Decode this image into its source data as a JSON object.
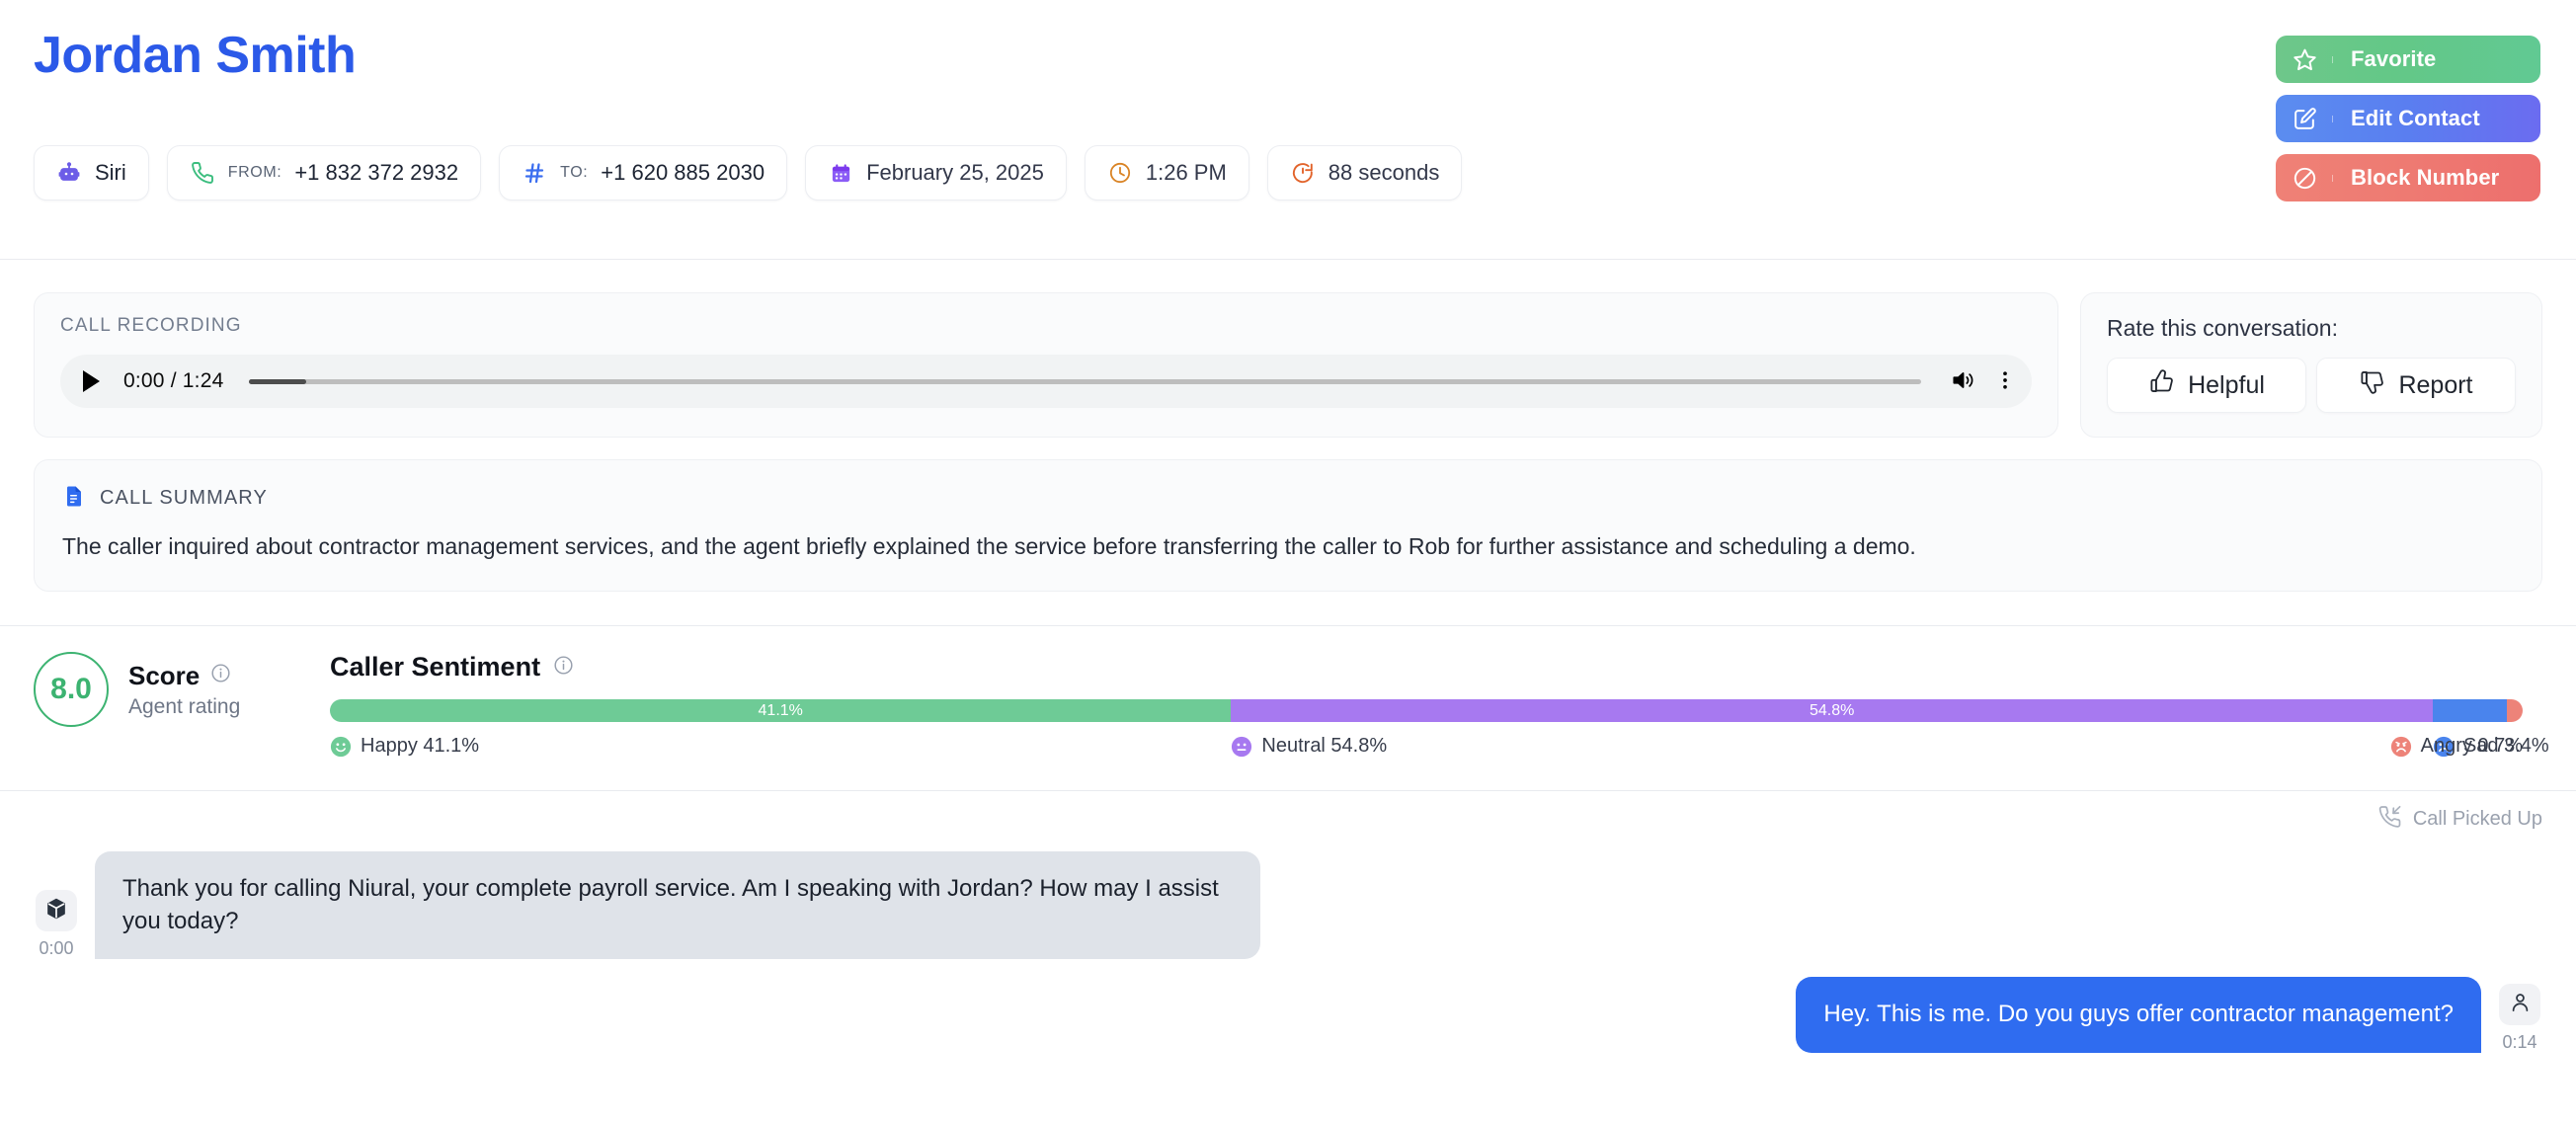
{
  "header": {
    "contact_name": "Jordan Smith",
    "chips": [
      {
        "icon": "robot-icon",
        "label": "",
        "value": "Siri"
      },
      {
        "icon": "phone-icon",
        "label": "FROM:",
        "value": "+1 832 372 2932"
      },
      {
        "icon": "hash-icon",
        "label": "TO:",
        "value": "+1 620 885 2030"
      },
      {
        "icon": "calendar-icon",
        "label": "",
        "value": "February 25, 2025"
      },
      {
        "icon": "clock-icon",
        "label": "",
        "value": "1:26 PM"
      },
      {
        "icon": "timer-icon",
        "label": "",
        "value": "88 seconds"
      }
    ],
    "actions": [
      {
        "icon": "star-icon",
        "label": "Favorite"
      },
      {
        "icon": "edit-pencil-icon",
        "label": "Edit Contact"
      },
      {
        "icon": "block-icon",
        "label": "Block Number"
      }
    ]
  },
  "recording": {
    "section_label": "CALL RECORDING",
    "current_time": "0:00",
    "duration": "1:24",
    "time_display": "0:00 / 1:24",
    "progress_percent": 0
  },
  "rate": {
    "prompt": "Rate this conversation:",
    "helpful_label": "Helpful",
    "report_label": "Report"
  },
  "summary": {
    "section_label": "CALL SUMMARY",
    "text": "The caller inquired about contractor management services, and the agent briefly explained the service before transferring the caller to Rob for further assistance and scheduling a demo."
  },
  "score": {
    "value": "8.0",
    "label": "Score",
    "sublabel": "Agent rating",
    "color": "#3cb371"
  },
  "sentiment": {
    "title": "Caller Sentiment"
  },
  "chart_data": {
    "type": "bar",
    "title": "Caller Sentiment",
    "orientation": "horizontal-stacked",
    "categories": [
      "Happy",
      "Neutral",
      "Sad",
      "Angry"
    ],
    "values": [
      41.1,
      54.8,
      3.4,
      0.7
    ],
    "value_labels": [
      "41.1%",
      "54.8%",
      "3.4%",
      "0.7%"
    ],
    "bar_labels": [
      "41.1%",
      "54.8%",
      "",
      ""
    ],
    "legend_labels": [
      "Happy 41.1%",
      "Neutral 54.8%",
      "Sad 3.4%",
      "Angry 0.7%"
    ],
    "colors": [
      "#6ecb96",
      "#a779f0",
      "#4a84ed",
      "#ed8379"
    ],
    "emojis": [
      "happy-face-icon",
      "neutral-face-icon",
      "sad-face-icon",
      "angry-face-icon"
    ],
    "total": 100,
    "legend": "bottom",
    "xlabel": "",
    "ylabel": ""
  },
  "transcript": {
    "call_status": "Call Picked Up",
    "messages": [
      {
        "speaker": "agent",
        "avatar": "cube-icon",
        "time": "0:00",
        "text": "Thank you for calling Niural, your complete payroll service. Am I speaking with Jordan? How may I assist you today?"
      },
      {
        "speaker": "user",
        "avatar": "person-icon",
        "time": "0:14",
        "text": "Hey. This is me. Do you guys offer contractor management?"
      }
    ]
  }
}
